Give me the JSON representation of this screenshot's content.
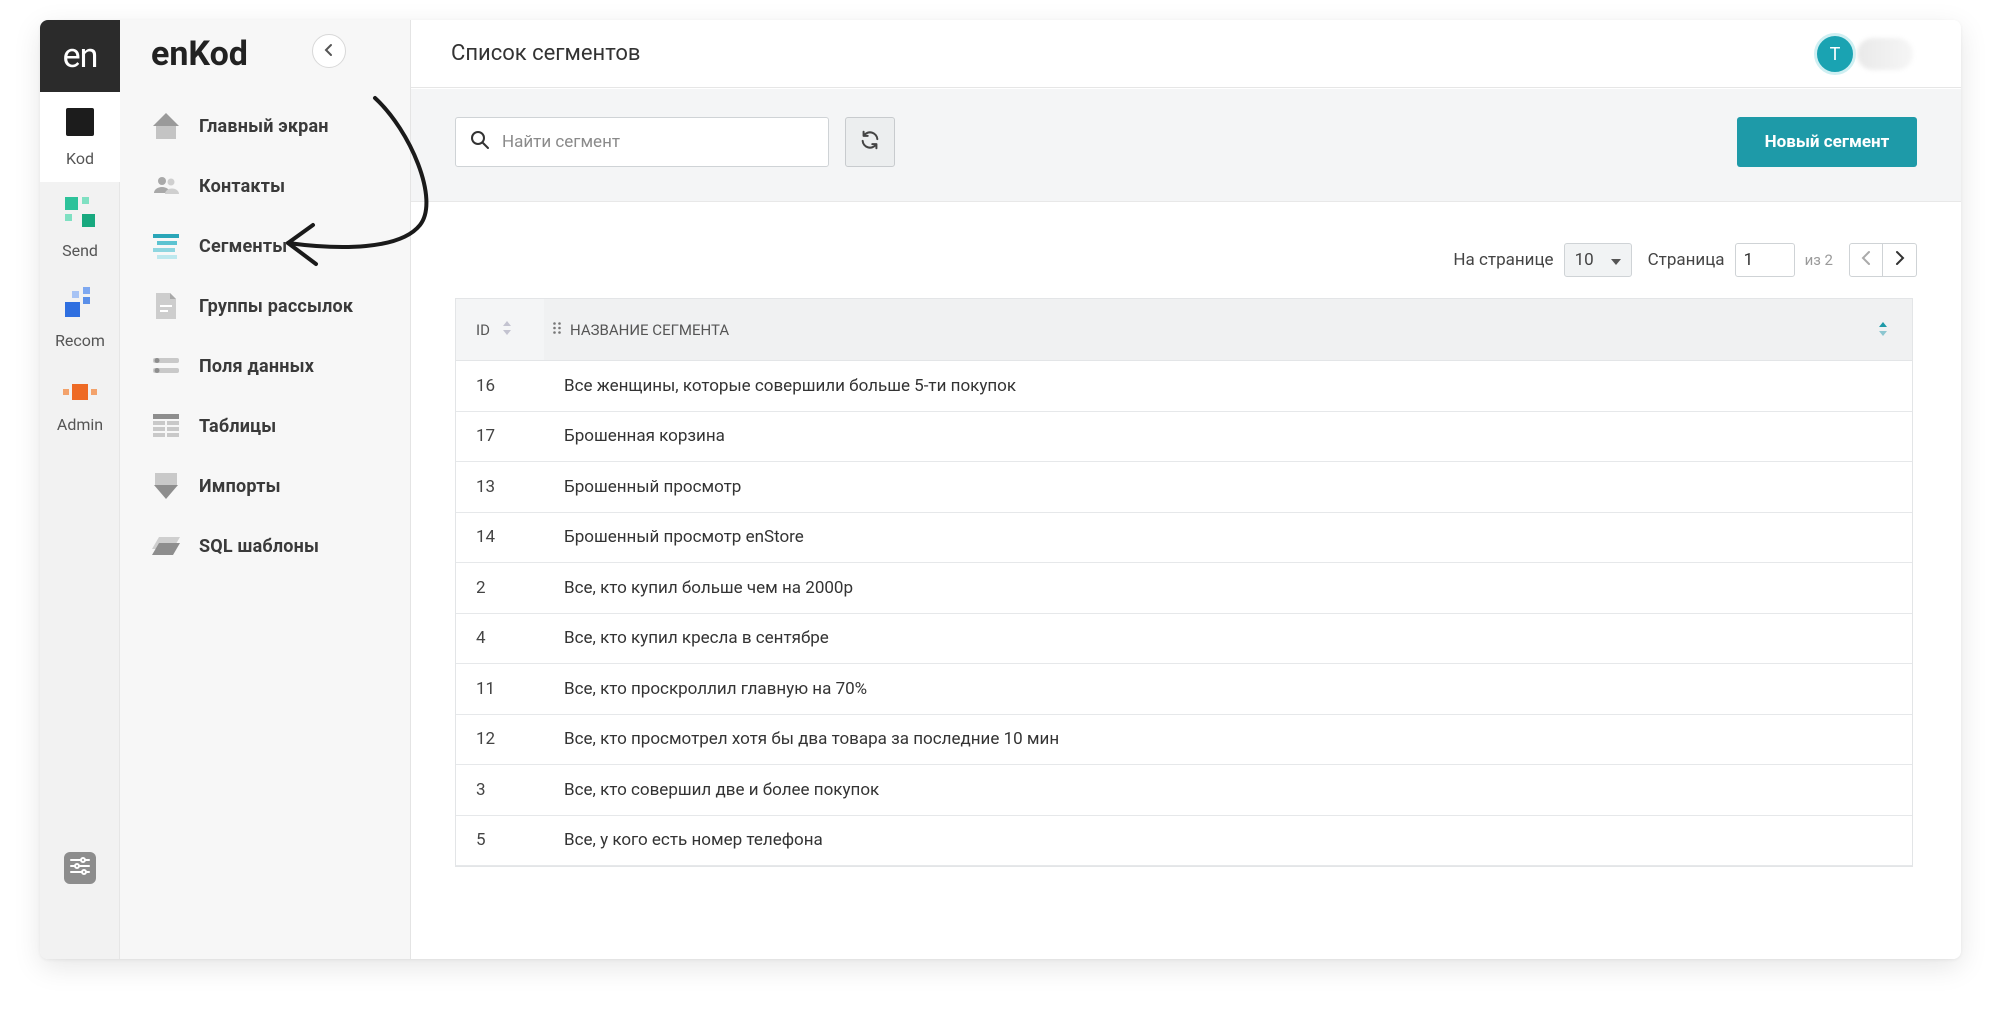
{
  "rail": {
    "logo": "en",
    "items": [
      {
        "label": "Kod"
      },
      {
        "label": "Send"
      },
      {
        "label": "Recom"
      },
      {
        "label": "Admin"
      }
    ]
  },
  "sidebar": {
    "brand": "enKod",
    "items": [
      {
        "label": "Главный экран",
        "icon": "home-icon"
      },
      {
        "label": "Контакты",
        "icon": "contacts-icon"
      },
      {
        "label": "Сегменты",
        "icon": "segments-icon"
      },
      {
        "label": "Группы рассылок",
        "icon": "document-icon"
      },
      {
        "label": "Поля данных",
        "icon": "fields-icon"
      },
      {
        "label": "Таблицы",
        "icon": "table-icon"
      },
      {
        "label": "Импорты",
        "icon": "import-icon"
      },
      {
        "label": "SQL шаблоны",
        "icon": "sql-icon"
      }
    ]
  },
  "header": {
    "title": "Список сегментов",
    "avatar_initial": "T"
  },
  "toolbar": {
    "search_placeholder": "Найти сегмент",
    "new_button": "Новый сегмент"
  },
  "pager": {
    "per_page_label": "На странице",
    "per_page_value": "10",
    "page_label": "Страница",
    "page_value": "1",
    "of_total": "из 2"
  },
  "table": {
    "columns": [
      "ID",
      "НАЗВАНИЕ СЕГМЕНТА"
    ],
    "rows": [
      {
        "id": "16",
        "name": "Все женщины, которые совершили больше 5-ти покупок"
      },
      {
        "id": "17",
        "name": "Брошенная корзина"
      },
      {
        "id": "13",
        "name": "Брошенный просмотр"
      },
      {
        "id": "14",
        "name": "Брошенный просмотр enStore"
      },
      {
        "id": "2",
        "name": "Все, кто купил больше чем на 2000р"
      },
      {
        "id": "4",
        "name": "Все, кто купил кресла в сентябре"
      },
      {
        "id": "11",
        "name": "Все, кто проскроллил главную на 70%"
      },
      {
        "id": "12",
        "name": "Все, кто просмотрел хотя бы два товара за последние 10 мин"
      },
      {
        "id": "3",
        "name": "Все, кто совершил две и более покупок"
      },
      {
        "id": "5",
        "name": "Все, у кого есть номер телефона"
      }
    ]
  },
  "colors": {
    "accent": "#1e9aa8",
    "rail_bg": "#f2f2f2",
    "logo_bg": "#2b2b2b"
  }
}
